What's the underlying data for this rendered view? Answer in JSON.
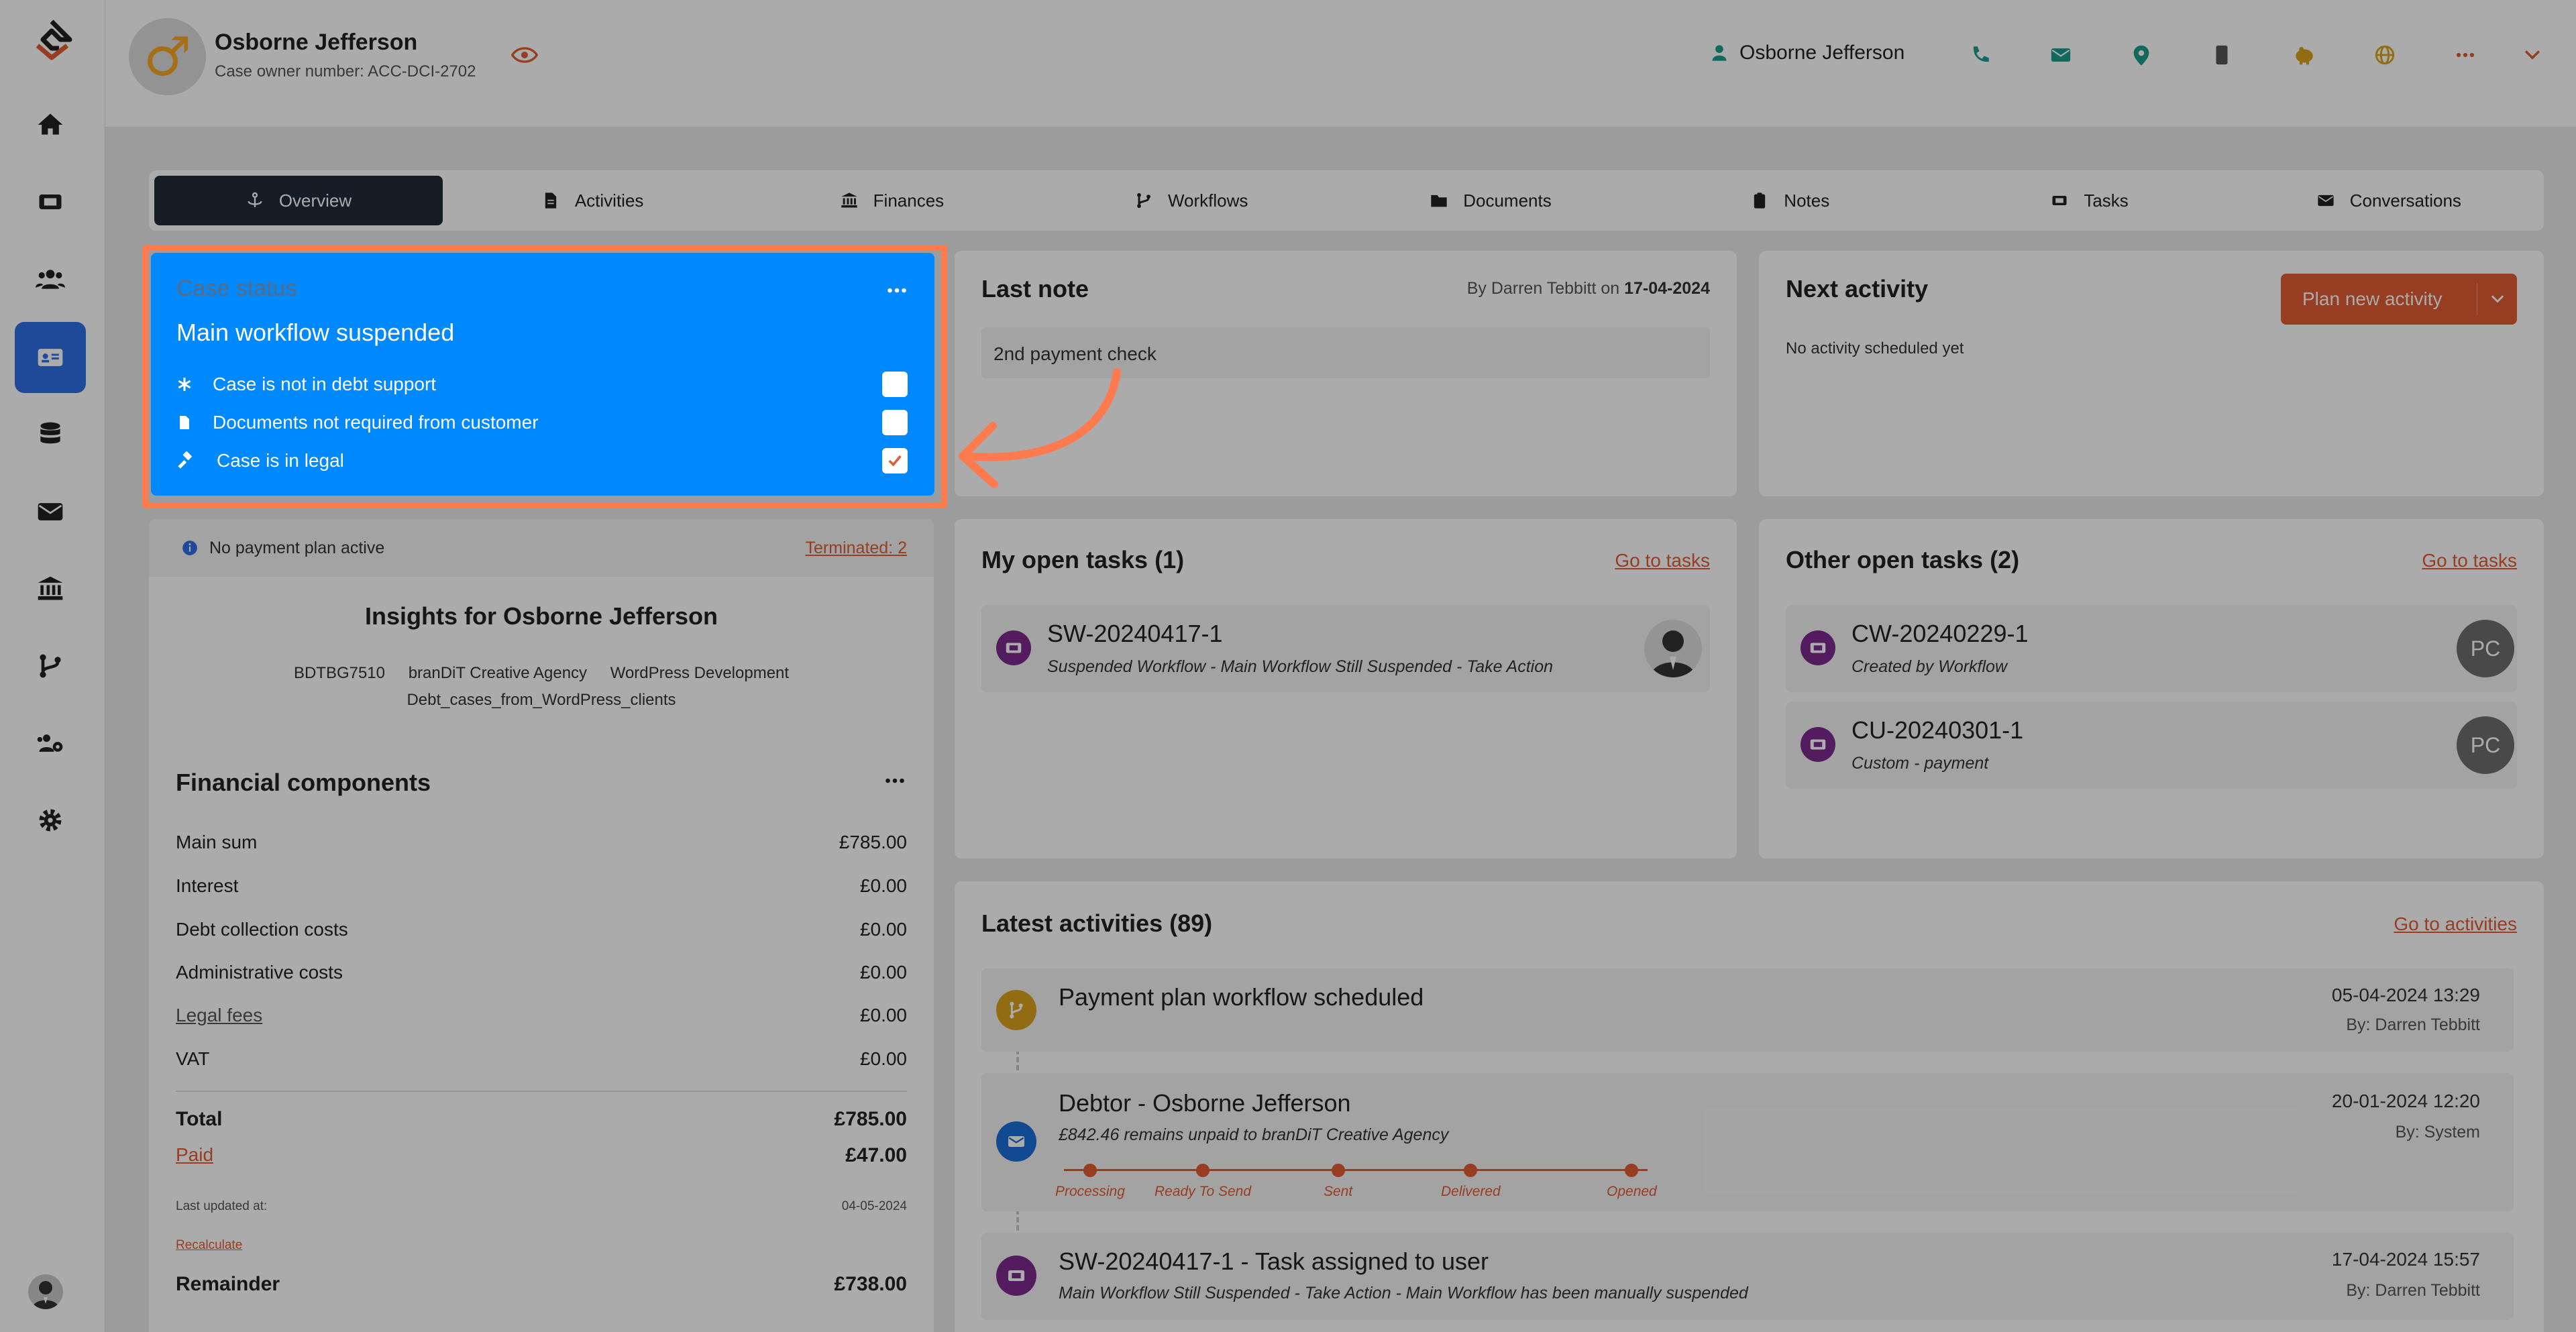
{
  "header": {
    "case_name": "Osborne Jefferson",
    "case_owner": "Case owner number: ACC-DCI-2702",
    "user_name": "Osborne Jefferson"
  },
  "tabs": [
    {
      "label": "Overview",
      "icon": "anchor-icon"
    },
    {
      "label": "Activities",
      "icon": "file-icon"
    },
    {
      "label": "Finances",
      "icon": "bank-icon"
    },
    {
      "label": "Workflows",
      "icon": "branch-icon"
    },
    {
      "label": "Documents",
      "icon": "folder-icon"
    },
    {
      "label": "Notes",
      "icon": "clipboard-icon"
    },
    {
      "label": "Tasks",
      "icon": "ticket-icon"
    },
    {
      "label": "Conversations",
      "icon": "envelope-icon"
    }
  ],
  "case_status": {
    "title": "Case status",
    "main": "Main workflow suspended",
    "items": [
      {
        "label": "Case is not in debt support",
        "checked": false
      },
      {
        "label": "Documents not required from customer",
        "checked": false
      },
      {
        "label": "Case is in legal",
        "checked": true
      }
    ]
  },
  "payment_plan": {
    "status": "No payment plan active",
    "terminated": "Terminated: 2"
  },
  "insights": {
    "title": "Insights for Osborne Jefferson",
    "tags": [
      "BDTBG7510",
      "branDiT Creative Agency",
      "WordPress Development",
      "Debt_cases_from_WordPress_clients"
    ]
  },
  "financial": {
    "title": "Financial components",
    "rows": [
      {
        "label": "Main sum",
        "value": "£785.00"
      },
      {
        "label": "Interest",
        "value": "£0.00"
      },
      {
        "label": "Debt collection costs",
        "value": "£0.00"
      },
      {
        "label": "Administrative costs",
        "value": "£0.00"
      },
      {
        "label": "Legal fees",
        "value": "£0.00"
      },
      {
        "label": "VAT",
        "value": "£0.00"
      }
    ],
    "total_label": "Total",
    "total_value": "£785.00",
    "paid_label": "Paid",
    "paid_value": "£47.00",
    "last_updated_label": "Last updated at:",
    "last_updated_value": "04-05-2024",
    "recalculate": "Recalculate",
    "remainder_label": "Remainder",
    "remainder_value": "£738.00"
  },
  "last_note": {
    "title": "Last note",
    "by_prefix": "By Darren Tebbitt on",
    "date": "17-04-2024",
    "text": "2nd payment check"
  },
  "next_activity": {
    "title": "Next activity",
    "button": "Plan new activity",
    "empty": "No activity scheduled yet"
  },
  "my_tasks": {
    "title": "My open tasks (1)",
    "link": "Go to tasks",
    "items": [
      {
        "id": "SW-20240417-1",
        "sub": "Suspended Workflow - Main Workflow Still Suspended - Take Action"
      }
    ]
  },
  "other_tasks": {
    "title": "Other open tasks (2)",
    "link": "Go to tasks",
    "items": [
      {
        "id": "CW-20240229-1",
        "sub": "Created by Workflow",
        "initials": "PC"
      },
      {
        "id": "CU-20240301-1",
        "sub": "Custom - payment",
        "initials": "PC"
      }
    ]
  },
  "activities": {
    "title": "Latest activities (89)",
    "link": "Go to activities",
    "items": [
      {
        "title": "Payment plan workflow scheduled",
        "sub": "",
        "date": "05-04-2024 13:29",
        "by": "By: Darren Tebbitt",
        "icon": "branch-icon",
        "color": "#d9a21b"
      },
      {
        "title": "Debtor - Osborne Jefferson",
        "sub": "£842.46 remains unpaid to branDiT Creative Agency",
        "date": "20-01-2024 12:20",
        "by": "By: System",
        "icon": "envelope-icon",
        "color": "#1c6fd8"
      },
      {
        "title": "SW-20240417-1 - Task assigned to user",
        "sub": "Main Workflow Still Suspended - Take Action - Main Workflow has been manually suspended",
        "date": "17-04-2024 15:57",
        "by": "By: Darren Tebbitt",
        "icon": "ticket-icon",
        "color": "#7b2b8c"
      }
    ],
    "steps": [
      "Processing",
      "Ready To Send",
      "Sent",
      "Delivered",
      "Opened"
    ]
  },
  "colors": {
    "accent": "#e05b34",
    "status_blue": "#0088ff",
    "sidebar_active": "#2f6fe4",
    "highlight": "#ff7a4f",
    "task_purple": "#7b2b8c"
  }
}
